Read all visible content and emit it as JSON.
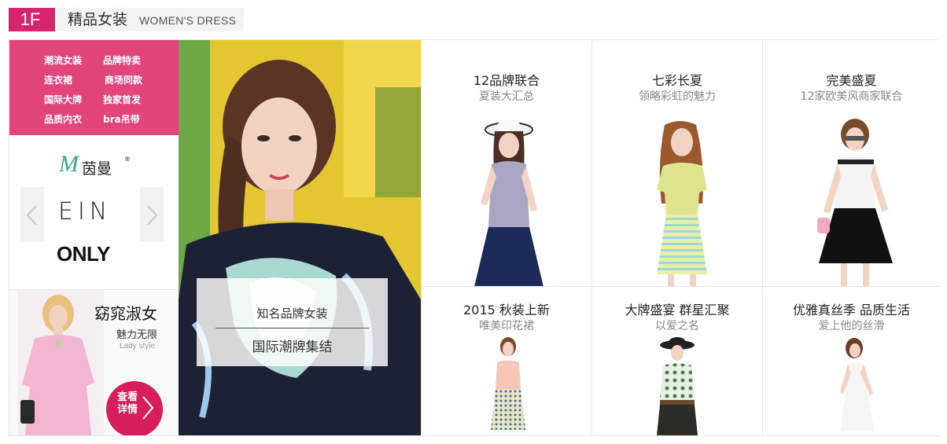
{
  "floor": {
    "badge": "1F",
    "title_cn": "精品女装",
    "title_en": "WOMEN'S DRESS",
    "accent_color": "#d6256e"
  },
  "categories": [
    "潮流女装",
    "品牌特卖",
    "连衣裙",
    "商场同款",
    "国际大牌",
    "独家首发",
    "品质内衣",
    "bra吊带"
  ],
  "brands": {
    "logo1_mark": "M",
    "logo1_name": "茵曼",
    "logo1_reg": "®",
    "logo2": "EIN",
    "logo3": "ONLY",
    "prev_icon": "chevron-left-icon",
    "next_icon": "chevron-right-icon"
  },
  "promo": {
    "title": "窈窕淑女",
    "subtitle": "魅力无限",
    "subtitle_en": "Lady style",
    "button_label": "查看详情"
  },
  "hero": {
    "caption_top": "知名品牌女装",
    "caption_bottom": "国际潮牌集结"
  },
  "products": [
    {
      "title": "12品牌联合",
      "subtitle": "夏装大汇总"
    },
    {
      "title": "七彩长夏",
      "subtitle": "领略彩虹的魅力"
    },
    {
      "title": "完美盛夏",
      "subtitle": "12家欧美风商家联合"
    },
    {
      "title": "2015 秋装上新",
      "subtitle": "唯美印花裙"
    },
    {
      "title": "大牌盛宴 群星汇聚",
      "subtitle": "以爱之名"
    },
    {
      "title": "优雅真丝季 品质生活",
      "subtitle": "爱上他的丝滑"
    }
  ]
}
